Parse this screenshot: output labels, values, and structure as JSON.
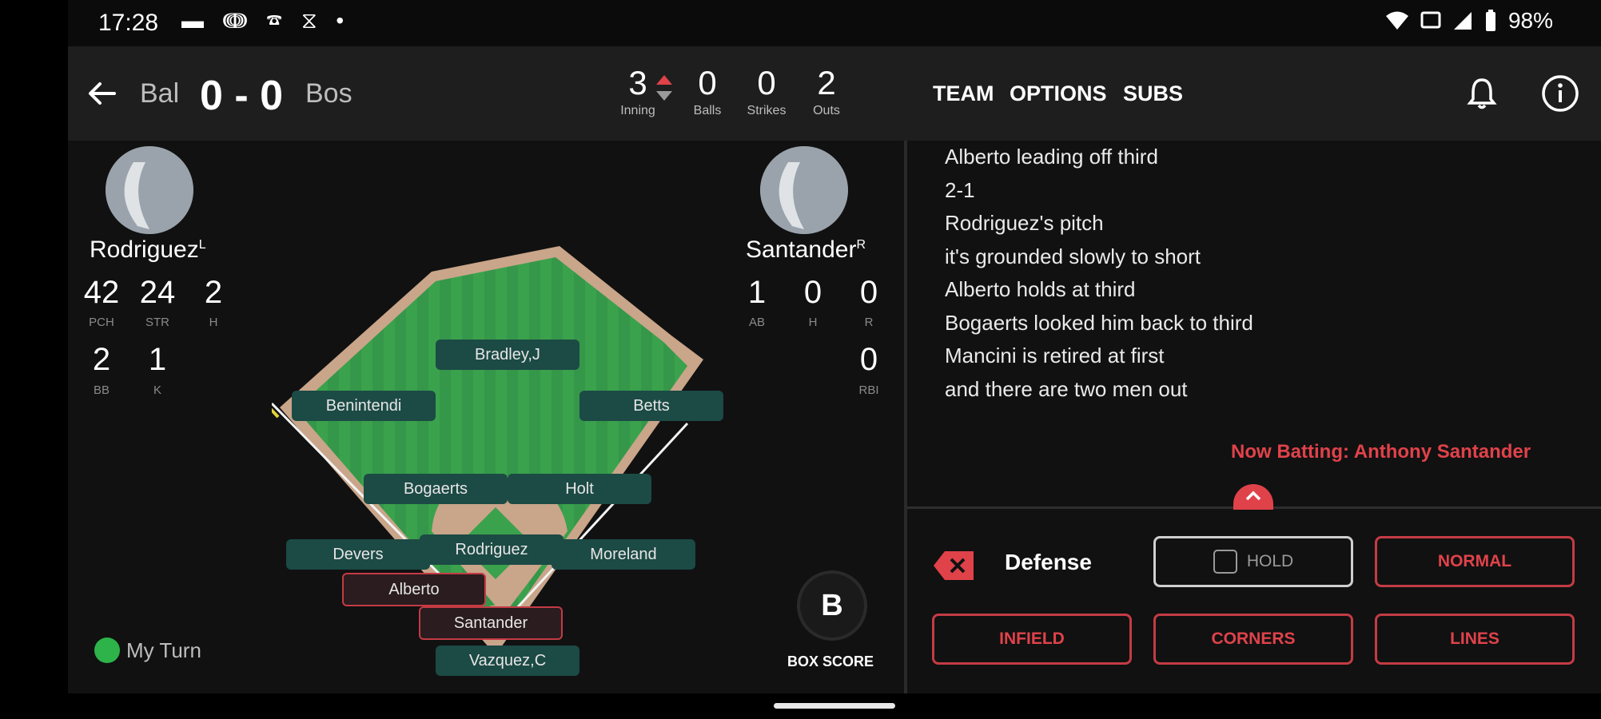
{
  "status_bar": {
    "time": "17:28",
    "battery": "98%",
    "icons": [
      "notification-icon",
      "app-icon",
      "call-icon",
      "alarm-icon",
      "dot-icon",
      "wifi-icon",
      "cast-icon",
      "signal-icon",
      "battery-icon"
    ]
  },
  "header": {
    "away_team": "Bal",
    "score": "0 - 0",
    "home_team": "Bos",
    "inning": {
      "value": "3",
      "label": "Inning"
    },
    "balls": {
      "value": "0",
      "label": "Balls"
    },
    "strikes": {
      "value": "0",
      "label": "Strikes"
    },
    "outs": {
      "value": "2",
      "label": "Outs"
    },
    "nav": [
      "TEAM",
      "OPTIONS",
      "SUBS"
    ]
  },
  "pitcher": {
    "name": "Rodriguez",
    "hand": "L",
    "stats": [
      {
        "value": "42",
        "label": "PCH"
      },
      {
        "value": "24",
        "label": "STR"
      },
      {
        "value": "2",
        "label": "H"
      },
      {
        "value": "2",
        "label": "BB"
      },
      {
        "value": "1",
        "label": "K"
      }
    ]
  },
  "batter": {
    "name": "Santander",
    "hand": "R",
    "stats": [
      {
        "value": "1",
        "label": "AB"
      },
      {
        "value": "0",
        "label": "H"
      },
      {
        "value": "0",
        "label": "R"
      },
      {
        "value": "0",
        "label": "RBI"
      }
    ]
  },
  "field": {
    "positions": {
      "cf": "Bradley,J",
      "lf": "Benintendi",
      "rf": "Betts",
      "ss": "Bogaerts",
      "2b": "Holt",
      "3b": "Devers",
      "p": "Rodriguez",
      "1b": "Moreland",
      "c": "Vazquez,C"
    },
    "runners": {
      "third": "Alberto",
      "batter": "Santander"
    }
  },
  "my_turn": "My Turn",
  "box_score": {
    "button": "B",
    "label": "BOX SCORE"
  },
  "play_by_play": [
    "Alberto leading off third",
    "2-1",
    "Rodriguez's pitch",
    "it's grounded slowly to short",
    "Alberto holds at third",
    "Bogaerts looked him back to third",
    "Mancini is retired at first",
    "and there are two men out"
  ],
  "now_batting": "Now Batting: Anthony Santander",
  "defense": {
    "label": "Defense",
    "hold": "HOLD",
    "normal": "NORMAL",
    "infield": "INFIELD",
    "corners": "CORNERS",
    "lines": "LINES"
  },
  "colors": {
    "accent": "#e0424a",
    "field_green": "#3ca34e",
    "dirt": "#c9a58a",
    "marker_bg": "#1c4a45",
    "go_dot": "#2db34a"
  }
}
